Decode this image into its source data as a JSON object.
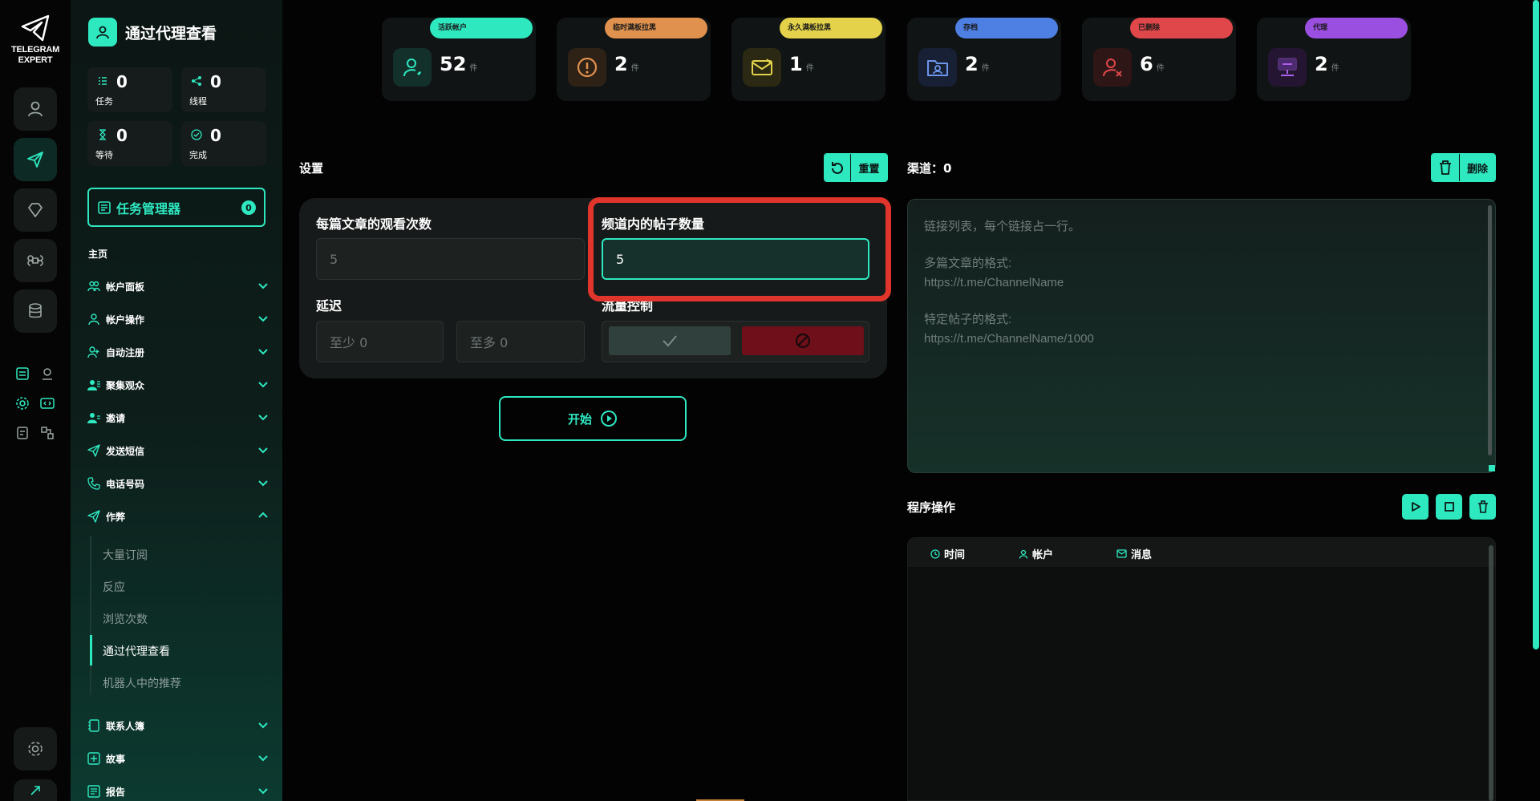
{
  "app": {
    "logo_text_line1": "TELEGRAM",
    "logo_text_line2": "EXPERT",
    "title": "通过代理查看"
  },
  "stats": {
    "tasks": {
      "value": "0",
      "label": "任务"
    },
    "threads": {
      "value": "0",
      "label": "线程"
    },
    "waiting": {
      "value": "0",
      "label": "等待"
    },
    "done": {
      "value": "0",
      "label": "完成"
    }
  },
  "task_manager": {
    "label": "任务管理器",
    "badge": "0"
  },
  "nav": {
    "section": "主页",
    "items": [
      {
        "label": "帐户面板",
        "icon": "users-icon"
      },
      {
        "label": "帐户操作",
        "icon": "user-icon"
      },
      {
        "label": "自动注册",
        "icon": "user-plus-icon"
      },
      {
        "label": "聚集观众",
        "icon": "group-icon"
      },
      {
        "label": "邀请",
        "icon": "invite-icon"
      },
      {
        "label": "发送短信",
        "icon": "send-icon"
      },
      {
        "label": "电话号码",
        "icon": "phone-icon"
      },
      {
        "label": "作弊",
        "icon": "cheat-send-icon"
      }
    ],
    "sub_items": [
      "大量订阅",
      "反应",
      "浏览次数",
      "通过代理查看",
      "机器人中的推荐"
    ],
    "bottom_items": [
      {
        "label": "联系人簿",
        "icon": "contacts-icon"
      },
      {
        "label": "故事",
        "icon": "story-icon"
      },
      {
        "label": "报告",
        "icon": "report-icon"
      }
    ]
  },
  "top_cards": [
    {
      "pill": "活跃帐户",
      "value": "52",
      "unit": "件",
      "color": "#2ee8c0",
      "icon": "active-user-icon"
    },
    {
      "pill": "临时满板拉黑",
      "value": "2",
      "unit": "件",
      "color": "#e0914e",
      "icon": "warning-icon"
    },
    {
      "pill": "永久满板拉黑",
      "value": "1",
      "unit": "件",
      "color": "#e3d24a",
      "icon": "mail-block-icon"
    },
    {
      "pill": "存档",
      "value": "2",
      "unit": "件",
      "color": "#4e7fe3",
      "icon": "archive-icon"
    },
    {
      "pill": "已删除",
      "value": "6",
      "unit": "件",
      "color": "#e0474a",
      "icon": "user-remove-icon"
    },
    {
      "pill": "代理",
      "value": "2",
      "unit": "件",
      "color": "#9a4fe0",
      "icon": "proxy-icon"
    }
  ],
  "settings": {
    "title": "设置",
    "reset_label": "重置",
    "views_per_post_label": "每篇文章的观看次数",
    "views_per_post_placeholder": "5",
    "posts_in_channel_label": "频道内的帖子数量",
    "posts_in_channel_value": "5",
    "delay_label": "延迟",
    "delay_min_placeholder": "至少  0",
    "delay_max_placeholder": "至多  0",
    "traffic_label": "流量控制",
    "start_label": "开始"
  },
  "channels": {
    "title": "渠道：0",
    "delete_label": "删除",
    "placeholder_line1": "链接列表，每个链接占一行。",
    "placeholder_line2": "多篇文章的格式:",
    "placeholder_line3": "https://t.me/ChannelName",
    "placeholder_line4": "特定帖子的格式:",
    "placeholder_line5": "https://t.me/ChannelName/1000"
  },
  "log": {
    "title": "程序操作",
    "col_time": "时间",
    "col_account": "帐户",
    "col_message": "消息"
  },
  "colors": {
    "accent": "#2ee8c0",
    "highlight": "#e0352c",
    "disabled_red": "#6e0f1a"
  }
}
